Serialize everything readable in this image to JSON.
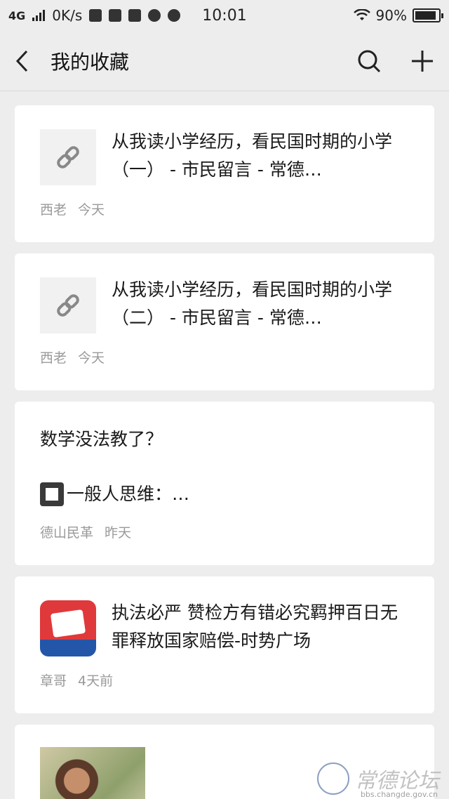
{
  "status_bar": {
    "network": "4G",
    "speed": "0K/s",
    "time": "10:01",
    "battery": "90%"
  },
  "nav": {
    "title": "我的收藏"
  },
  "items": [
    {
      "title": "从我读小学经历，看民国时期的小学（一） - 市民留言 - 常德…",
      "author": "西老",
      "time": "今天"
    },
    {
      "title": "从我读小学经历，看民国时期的小学（二） - 市民留言 - 常德…",
      "author": "西老",
      "time": "今天"
    },
    {
      "text_line1": "数学没法教了？",
      "text_line2": "一般人思维：…",
      "author": "德山民革",
      "time": "昨天"
    },
    {
      "title": "执法必严 赞检方有错必究羁押百日无罪释放国家赔偿-时势广场",
      "author": "章哥",
      "time": "4天前"
    }
  ],
  "watermark": {
    "text": "常德论坛",
    "url": "bbs.changde.gov.cn"
  }
}
